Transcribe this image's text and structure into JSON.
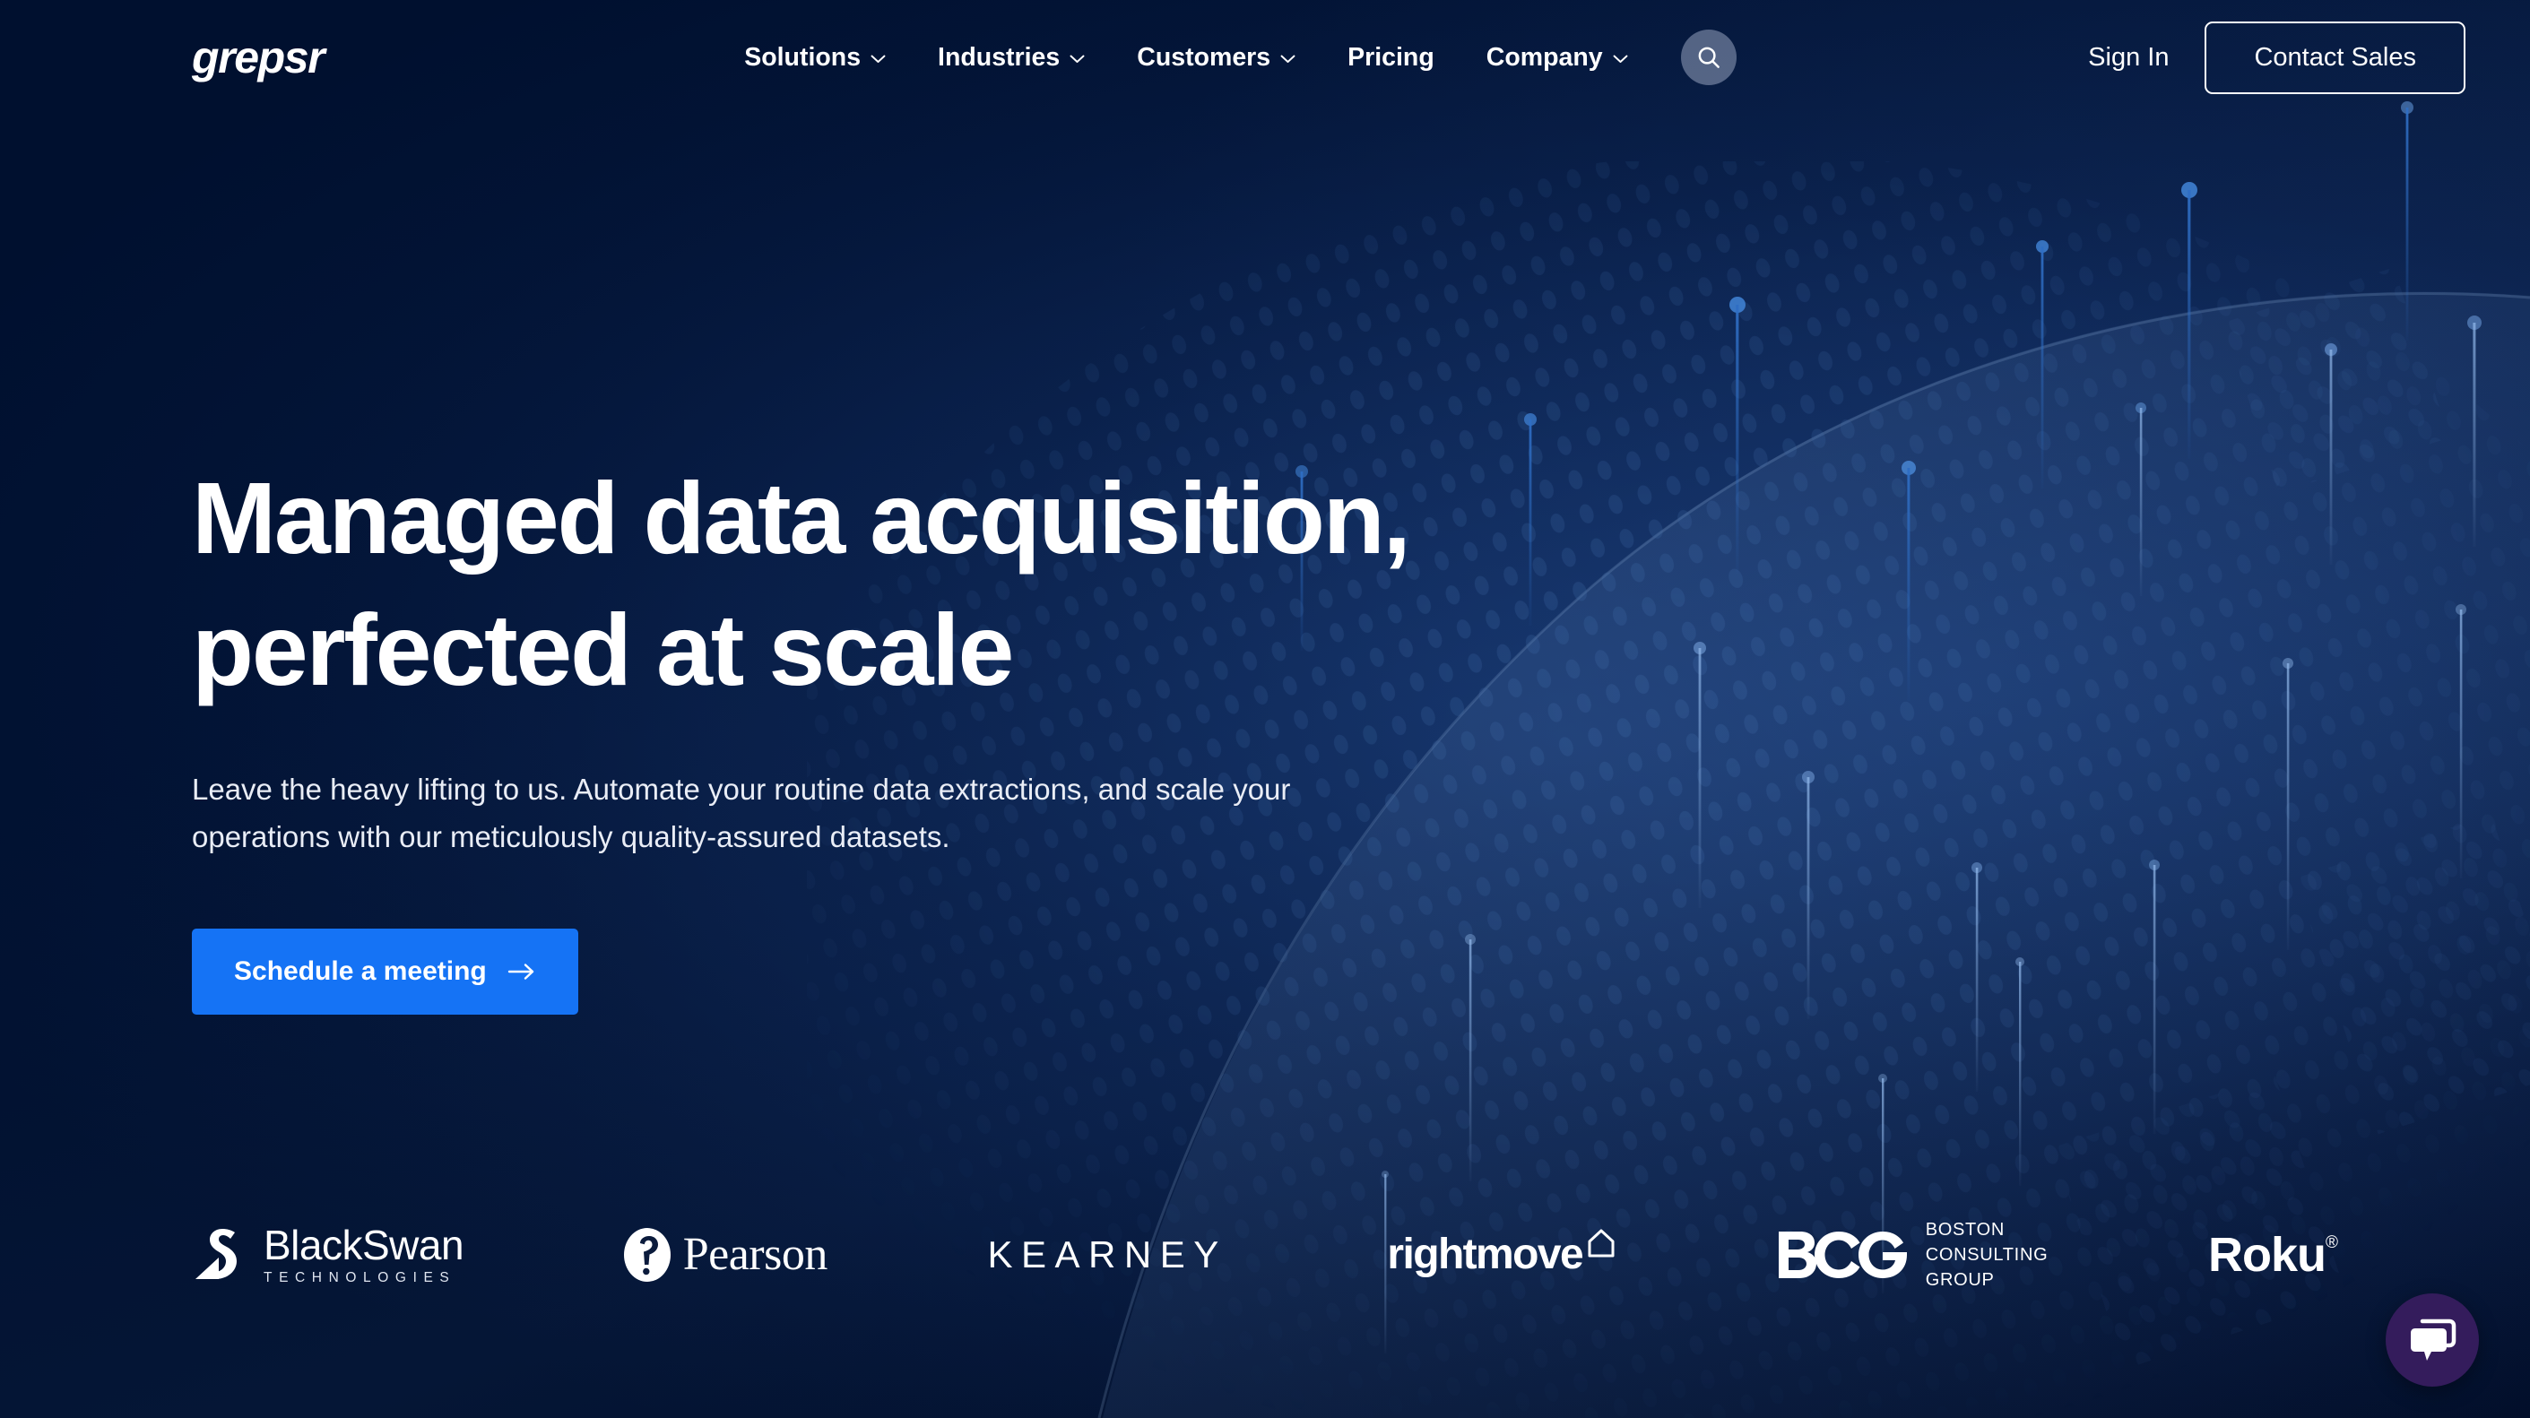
{
  "brand": {
    "logo_text": "grepsr"
  },
  "nav": {
    "items": [
      {
        "label": "Solutions",
        "has_dropdown": true,
        "icon": "chevron-down-icon"
      },
      {
        "label": "Industries",
        "has_dropdown": true,
        "icon": "chevron-down-icon"
      },
      {
        "label": "Customers",
        "has_dropdown": true,
        "icon": "chevron-down-icon"
      },
      {
        "label": "Pricing",
        "has_dropdown": false,
        "icon": ""
      },
      {
        "label": "Company",
        "has_dropdown": true,
        "icon": "chevron-down-icon"
      }
    ],
    "search_icon": "search-icon",
    "sign_in_label": "Sign In",
    "contact_label": "Contact Sales"
  },
  "hero": {
    "headline_line1": "Managed data acquisition,",
    "headline_line2": "perfected at scale",
    "subtitle_line1": "Leave the heavy lifting to us. Automate your routine data extractions, and scale your",
    "subtitle_line2": "operations with our meticulously quality-assured datasets.",
    "cta_label": "Schedule a meeting",
    "cta_icon": "arrow-right-icon"
  },
  "logo_strip": {
    "logos": [
      {
        "name": "BlackSwan",
        "text": "BlackSwan",
        "subtext": "TECHNOLOGIES",
        "icon": "swan-icon"
      },
      {
        "name": "Pearson",
        "text": "Pearson",
        "subtext": "",
        "icon": "pearson-p-icon"
      },
      {
        "name": "Kearney",
        "text": "KEARNEY",
        "subtext": "",
        "icon": ""
      },
      {
        "name": "rightmove",
        "text": "rightmove",
        "subtext": "",
        "icon": "house-icon"
      },
      {
        "name": "BCG",
        "text": "BCG",
        "subtext": "BOSTON|CONSULTING|GROUP",
        "icon": "bcg-monogram-icon"
      },
      {
        "name": "Roku",
        "text": "Roku",
        "subtext": "®",
        "icon": ""
      }
    ],
    "bcg_line1": "BOSTON",
    "bcg_line2": "CONSULTING",
    "bcg_line3": "GROUP",
    "blackswan_name": "BlackSwan",
    "blackswan_sub": "TECHNOLOGIES",
    "pearson_name": "Pearson",
    "kearney_name": "KEARNEY",
    "rightmove_name": "rightmove",
    "roku_name": "Roku",
    "roku_tm": "®"
  },
  "chat": {
    "icon": "chat-bubble-icon",
    "aria_label": "Open chat"
  },
  "colors": {
    "background": "#000d2b",
    "accent_blue": "#1573f5",
    "text_primary": "#ffffff",
    "text_secondary": "#e9edf6",
    "chat_purple": "#341c5c",
    "search_circle": "#96a3be"
  }
}
